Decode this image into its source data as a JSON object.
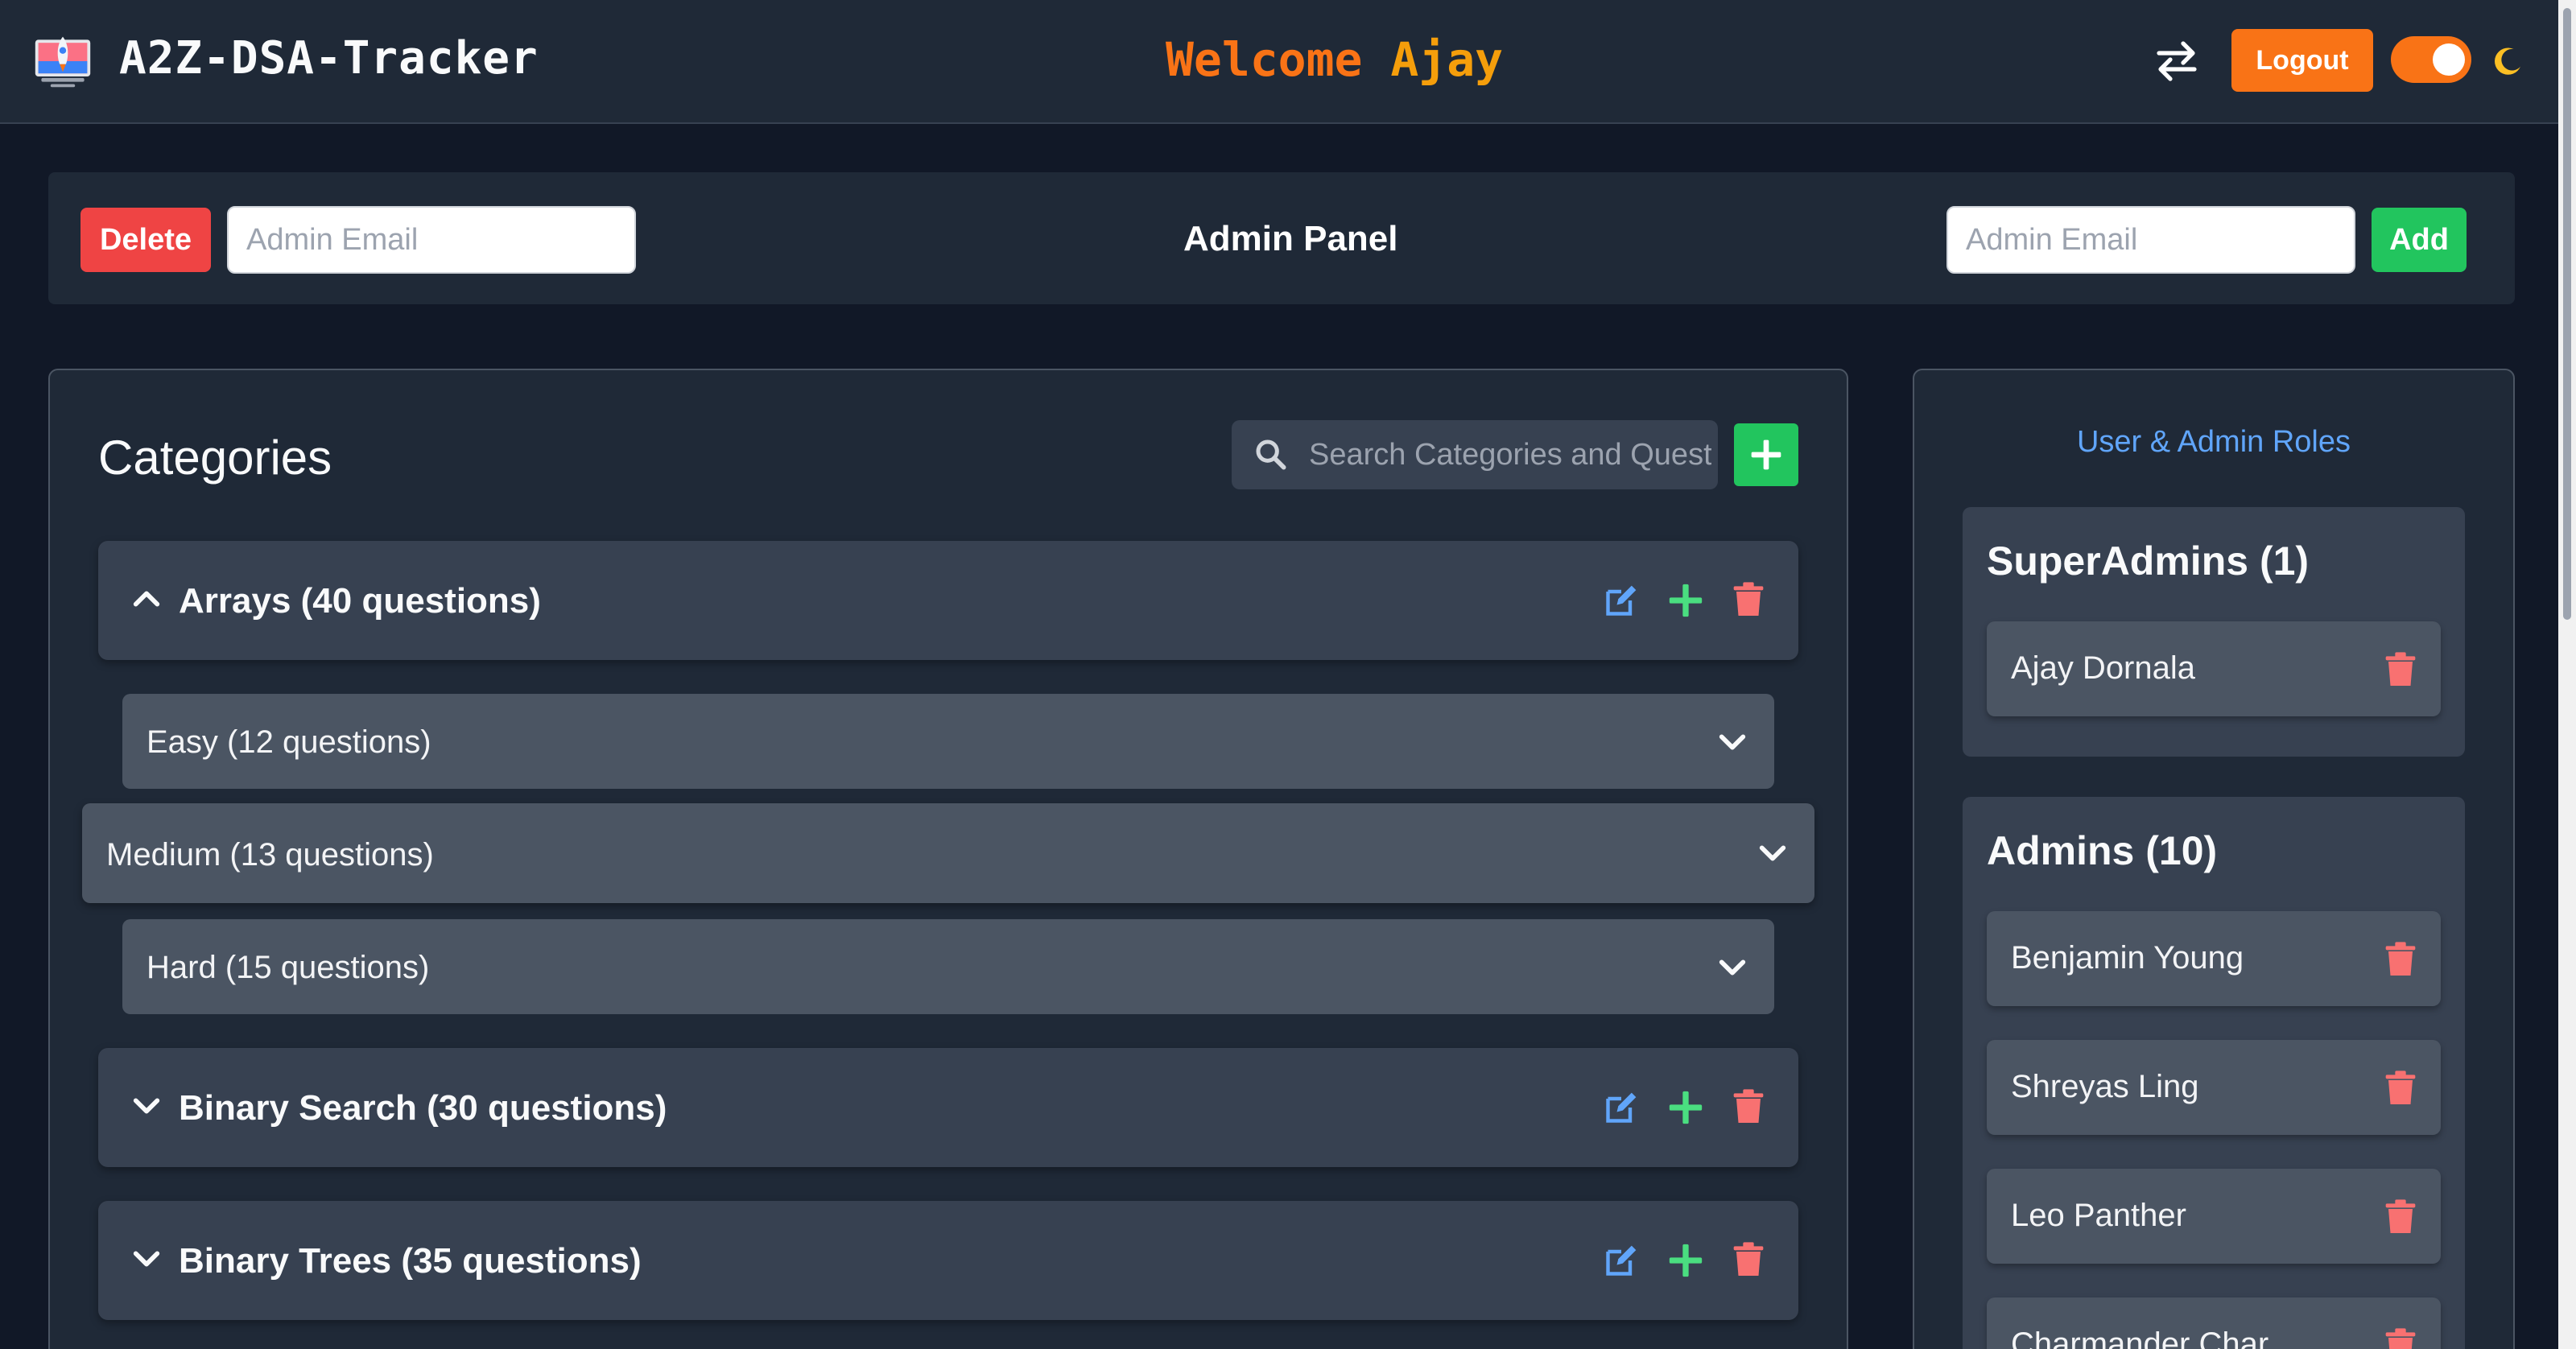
{
  "header": {
    "brand": "A2Z-DSA-Tracker",
    "welcome_prefix": "Welcome",
    "welcome_name": "Ajay",
    "logout_label": "Logout",
    "theme_toggle_on": true
  },
  "admin_panel": {
    "title": "Admin Panel",
    "delete_label": "Delete",
    "add_label": "Add",
    "delete_email_placeholder": "Admin Email",
    "add_email_placeholder": "Admin Email"
  },
  "categories": {
    "title": "Categories",
    "search_placeholder": "Search Categories and Questions",
    "items": [
      {
        "label": "Arrays (40 questions)",
        "expanded": true,
        "difficulties": [
          {
            "label": "Easy (12 questions)"
          },
          {
            "label": "Medium (13 questions)"
          },
          {
            "label": "Hard (15 questions)"
          }
        ]
      },
      {
        "label": "Binary Search (30 questions)",
        "expanded": false
      },
      {
        "label": "Binary Trees (35 questions)",
        "expanded": false
      }
    ]
  },
  "roles": {
    "title": "User & Admin Roles",
    "superadmins": {
      "title": "SuperAdmins (1)",
      "users": [
        "Ajay Dornala"
      ]
    },
    "admins": {
      "title": "Admins (10)",
      "users": [
        "Benjamin Young",
        "Shreyas Ling",
        "Leo Panther",
        "Charmander Char"
      ]
    }
  },
  "colors": {
    "accent_orange": "#f97316",
    "danger": "#ef4444",
    "success": "#22c55e",
    "link_blue": "#60a5fa",
    "edit_blue": "#60a5fa",
    "plus_green": "#4ade80",
    "trash_pink": "#f87171"
  },
  "icons": [
    "rocket-logo-icon",
    "swap-arrows-icon",
    "moon-icon",
    "search-icon",
    "plus-icon",
    "edit-icon",
    "trash-icon",
    "chevron-up-icon",
    "chevron-down-icon"
  ]
}
